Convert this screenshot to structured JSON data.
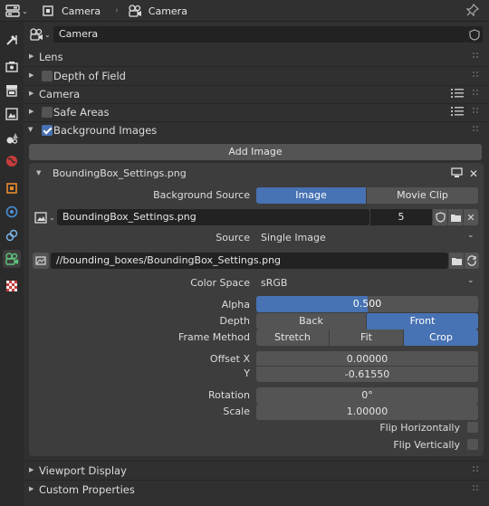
{
  "header": {
    "breadcrumb_1": "Camera",
    "breadcrumb_2": "Camera",
    "datablock_name": "Camera"
  },
  "panels": {
    "lens": "Lens",
    "depth_of_field": "Depth of Field",
    "camera": "Camera",
    "safe_areas": "Safe Areas",
    "background_images": "Background Images",
    "viewport_display": "Viewport Display",
    "custom_properties": "Custom Properties"
  },
  "bg": {
    "add_image": "Add Image",
    "image_title": "BoundingBox_Settings.png",
    "background_source_label": "Background Source",
    "source_image": "Image",
    "source_movie": "Movie Clip",
    "image_name": "BoundingBox_Settings.png",
    "users": "5",
    "source_label": "Source",
    "source_value": "Single Image",
    "filepath": "//bounding_boxes/BoundingBox_Settings.png",
    "color_space_label": "Color Space",
    "color_space_value": "sRGB",
    "alpha_label": "Alpha",
    "alpha_value": "0.500",
    "alpha_fraction": 0.5,
    "depth_label": "Depth",
    "depth_back": "Back",
    "depth_front": "Front",
    "frame_method_label": "Frame Method",
    "fm_stretch": "Stretch",
    "fm_fit": "Fit",
    "fm_crop": "Crop",
    "offset_x_label": "Offset X",
    "offset_x_value": "0.00000",
    "offset_y_label": "Y",
    "offset_y_value": "-0.61550",
    "rotation_label": "Rotation",
    "rotation_value": "0°",
    "scale_label": "Scale",
    "scale_value": "1.00000",
    "flip_h": "Flip Horizontally",
    "flip_v": "Flip Vertically"
  },
  "colors": {
    "accent": "#4772b3",
    "panel_bg": "#303030",
    "field_bg": "#222222",
    "button_bg": "#545454"
  }
}
